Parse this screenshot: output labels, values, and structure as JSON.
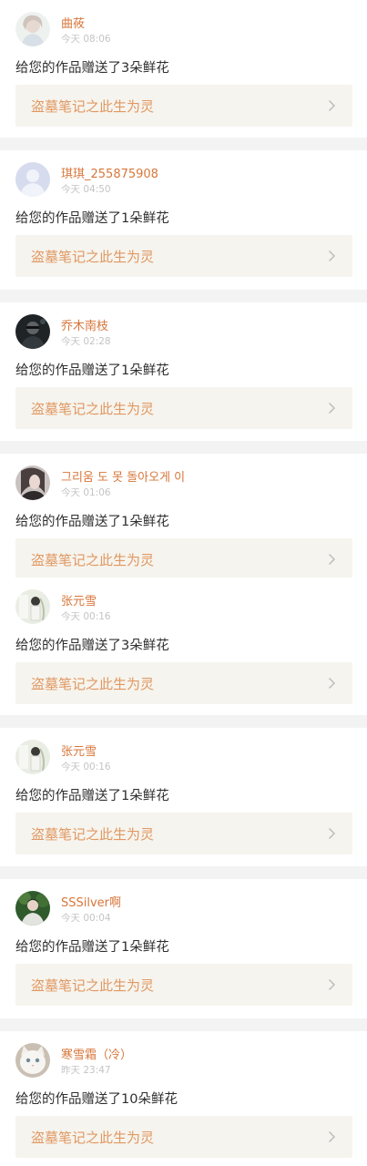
{
  "colors": {
    "username": "#d8763a",
    "time": "#c4c4c4",
    "message": "#2e2e2e",
    "link_bg": "#f6f4ee",
    "link_text": "#e09862",
    "separator": "#f3f3f3"
  },
  "notifications": [
    {
      "username": "曲莜",
      "time": "今天 08:06",
      "message": "给您的作品赠送了3朵鲜花",
      "work_title": "盗墓笔记之此生为灵",
      "avatar": "girl-illustration-avatar",
      "chevron_icon": "chevron-right-icon"
    },
    {
      "username": "琪琪_255875908",
      "time": "今天 04:50",
      "message": "给您的作品赠送了1朵鲜花",
      "work_title": "盗墓笔记之此生为灵",
      "avatar": "default-user-avatar",
      "chevron_icon": "chevron-right-icon"
    },
    {
      "username": "乔木南枝",
      "time": "今天 02:28",
      "message": "给您的作品赠送了1朵鲜花",
      "work_title": "盗墓笔记之此生为灵",
      "avatar": "dark-portrait-avatar",
      "chevron_icon": "chevron-right-icon"
    },
    {
      "username": "그리움 도 못 돌아오게 이",
      "time": "今天 01:06",
      "message": "给您的作品赠送了1朵鲜花",
      "work_title": "盗墓笔记之此生为灵",
      "avatar": "portrait-avatar",
      "chevron_icon": "chevron-right-icon"
    },
    {
      "username": "张元雪",
      "time": "今天 00:16",
      "message": "给您的作品赠送了3朵鲜花",
      "work_title": "盗墓笔记之此生为灵",
      "avatar": "light-photo-avatar",
      "chevron_icon": "chevron-right-icon"
    },
    {
      "username": "张元雪",
      "time": "今天 00:16",
      "message": "给您的作品赠送了1朵鲜花",
      "work_title": "盗墓笔记之此生为灵",
      "avatar": "light-photo-avatar",
      "chevron_icon": "chevron-right-icon"
    },
    {
      "username": "SSSilver啊",
      "time": "今天 00:04",
      "message": "给您的作品赠送了1朵鲜花",
      "work_title": "盗墓笔记之此生为灵",
      "avatar": "green-photo-avatar",
      "chevron_icon": "chevron-right-icon"
    },
    {
      "username": "寒雪霜（冷）",
      "time": "昨天 23:47",
      "message": "给您的作品赠送了10朵鲜花",
      "work_title": "盗墓笔记之此生为灵",
      "avatar": "white-cat-avatar",
      "chevron_icon": "chevron-right-icon"
    }
  ]
}
